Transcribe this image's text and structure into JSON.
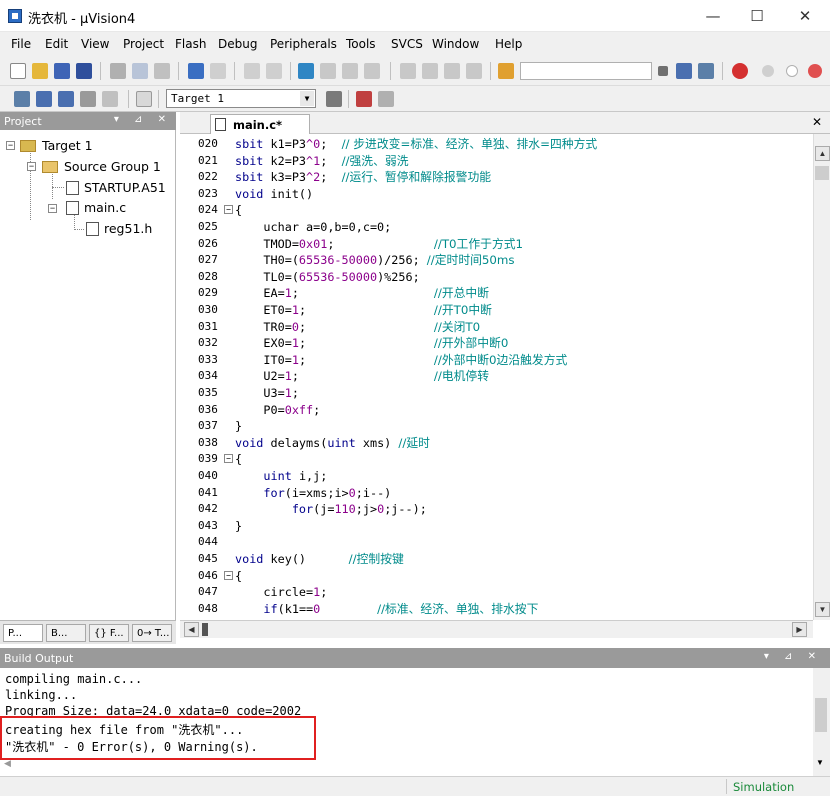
{
  "window": {
    "title": "洗衣机 - µVision4",
    "minimize": "—",
    "maximize": "☐",
    "close": "✕"
  },
  "menu": [
    "File",
    "Edit",
    "View",
    "Project",
    "Flash",
    "Debug",
    "Peripherals",
    "Tools",
    "SVCS",
    "Window",
    "Help"
  ],
  "toolbar": {
    "target": "Target 1"
  },
  "project_panel": {
    "title": "Project",
    "buttons": "▾ ⊿ ✕",
    "tree": {
      "target": "Target 1",
      "group": "Source Group 1",
      "startup": "STARTUP.A51",
      "main": "main.c",
      "header": "reg51.h"
    },
    "tabs": [
      "P...",
      "B...",
      "{} F...",
      "0→ T..."
    ]
  },
  "editor": {
    "tab": "main.c*",
    "close": "✕",
    "lines": [
      {
        "n": "020",
        "fold": "",
        "parts": [
          [
            "kw",
            "sbit "
          ],
          [
            "",
            "k1=P3"
          ],
          [
            "num",
            "^0"
          ],
          [
            "",
            ";  "
          ],
          [
            "cm",
            "//"
          ],
          [
            "cm",
            " 步进改变=标准、经济、单独、排水=四种方式"
          ]
        ]
      },
      {
        "n": "021",
        "fold": "",
        "parts": [
          [
            "kw",
            "sbit "
          ],
          [
            "",
            "k2=P3"
          ],
          [
            "num",
            "^1"
          ],
          [
            "",
            ";  "
          ],
          [
            "cm",
            "//强洗、弱洗"
          ]
        ]
      },
      {
        "n": "022",
        "fold": "",
        "parts": [
          [
            "kw",
            "sbit "
          ],
          [
            "",
            "k3=P3"
          ],
          [
            "num",
            "^2"
          ],
          [
            "",
            ";  "
          ],
          [
            "cm",
            "//运行、暂停和解除报警功能"
          ]
        ]
      },
      {
        "n": "023",
        "fold": "",
        "parts": [
          [
            "kw",
            "void "
          ],
          [
            "",
            "init()"
          ]
        ]
      },
      {
        "n": "024",
        "fold": "−",
        "parts": [
          [
            "",
            "{"
          ]
        ]
      },
      {
        "n": "025",
        "fold": "",
        "parts": [
          [
            "",
            "    uchar a=0,b=0,c=0;"
          ]
        ]
      },
      {
        "n": "026",
        "fold": "",
        "parts": [
          [
            "",
            "    TMOD="
          ],
          [
            "num",
            "0x01"
          ],
          [
            "",
            ";              "
          ],
          [
            "cm",
            "//T0工作于方式1"
          ]
        ]
      },
      {
        "n": "027",
        "fold": "",
        "parts": [
          [
            "",
            "    TH0=("
          ],
          [
            "num",
            "65536-50000"
          ],
          [
            ")",
            ")/256; "
          ],
          [
            "cm",
            "//定时时间50ms"
          ]
        ]
      },
      {
        "n": "028",
        "fold": "",
        "parts": [
          [
            "",
            "    TL0=("
          ],
          [
            "num",
            "65536-50000"
          ],
          [
            ")",
            ")%256;"
          ]
        ]
      },
      {
        "n": "029",
        "fold": "",
        "parts": [
          [
            "",
            "    EA="
          ],
          [
            "num",
            "1"
          ],
          [
            "",
            ";                   "
          ],
          [
            "cm",
            "//开总中断"
          ]
        ]
      },
      {
        "n": "030",
        "fold": "",
        "parts": [
          [
            "",
            "    ET0="
          ],
          [
            "num",
            "1"
          ],
          [
            "",
            ";                  "
          ],
          [
            "cm",
            "//开T0中断"
          ]
        ]
      },
      {
        "n": "031",
        "fold": "",
        "parts": [
          [
            "",
            "    TR0="
          ],
          [
            "num",
            "0"
          ],
          [
            "",
            ";                  "
          ],
          [
            "cm",
            "//关闭T0"
          ]
        ]
      },
      {
        "n": "032",
        "fold": "",
        "parts": [
          [
            "",
            "    EX0="
          ],
          [
            "num",
            "1"
          ],
          [
            "",
            ";                  "
          ],
          [
            "cm",
            "//开外部中断0"
          ]
        ]
      },
      {
        "n": "033",
        "fold": "",
        "parts": [
          [
            "",
            "    IT0="
          ],
          [
            "num",
            "1"
          ],
          [
            "",
            ";                  "
          ],
          [
            "cm",
            "//外部中断0边沿触发方式"
          ]
        ]
      },
      {
        "n": "034",
        "fold": "",
        "parts": [
          [
            "",
            "    U2="
          ],
          [
            "num",
            "1"
          ],
          [
            "",
            ";                   "
          ],
          [
            "cm",
            "//电机停转"
          ]
        ]
      },
      {
        "n": "035",
        "fold": "",
        "parts": [
          [
            "",
            "    U3="
          ],
          [
            "num",
            "1"
          ],
          [
            "",
            ";"
          ]
        ]
      },
      {
        "n": "036",
        "fold": "",
        "parts": [
          [
            "",
            "    P0="
          ],
          [
            "num",
            "0xff"
          ],
          [
            "",
            ";"
          ]
        ]
      },
      {
        "n": "037",
        "fold": "",
        "parts": [
          [
            "",
            "}"
          ]
        ]
      },
      {
        "n": "038",
        "fold": "",
        "parts": [
          [
            "kw",
            "void "
          ],
          [
            "",
            "delayms("
          ],
          [
            "kw",
            "uint "
          ],
          [
            "",
            "xms) "
          ],
          [
            "cm",
            "//延时"
          ]
        ]
      },
      {
        "n": "039",
        "fold": "−",
        "parts": [
          [
            "",
            "{"
          ]
        ]
      },
      {
        "n": "040",
        "fold": "",
        "parts": [
          [
            "",
            "    "
          ],
          [
            "kw",
            "uint "
          ],
          [
            "",
            "i,j;"
          ]
        ]
      },
      {
        "n": "041",
        "fold": "",
        "parts": [
          [
            "",
            "    "
          ],
          [
            "kw",
            "for"
          ],
          [
            "",
            "(i=xms;i>"
          ],
          [
            "num",
            "0"
          ],
          [
            "",
            ";i--)"
          ]
        ]
      },
      {
        "n": "042",
        "fold": "",
        "parts": [
          [
            "",
            "        "
          ],
          [
            "kw",
            "for"
          ],
          [
            "",
            "(j="
          ],
          [
            "num",
            "110"
          ],
          [
            "",
            ";j>"
          ],
          [
            "num",
            "0"
          ],
          [
            "",
            ";j--);"
          ]
        ]
      },
      {
        "n": "043",
        "fold": "",
        "parts": [
          [
            "",
            "}"
          ]
        ]
      },
      {
        "n": "044",
        "fold": "",
        "parts": [
          [
            "",
            ""
          ]
        ]
      },
      {
        "n": "045",
        "fold": "",
        "parts": [
          [
            "kw",
            "void "
          ],
          [
            "",
            "key()      "
          ],
          [
            "cm",
            "//控制按键"
          ]
        ]
      },
      {
        "n": "046",
        "fold": "−",
        "parts": [
          [
            "",
            "{"
          ]
        ]
      },
      {
        "n": "047",
        "fold": "",
        "parts": [
          [
            "",
            "    circle="
          ],
          [
            "num",
            "1"
          ],
          [
            "",
            ";"
          ]
        ]
      },
      {
        "n": "048",
        "fold": "",
        "parts": [
          [
            "",
            "    "
          ],
          [
            "kw",
            "if"
          ],
          [
            "",
            "(k1=="
          ],
          [
            "num",
            "0"
          ],
          [
            ")",
            "        "
          ],
          [
            "cm",
            "//标准、经济、单独、排水按下"
          ]
        ]
      }
    ]
  },
  "build_output": {
    "title": "Build Output",
    "buttons": "▾ ⊿ ✕",
    "lines": [
      "compiling main.c...",
      "linking...",
      "Program Size: data=24.0 xdata=0 code=2002",
      "creating hex file from \"洗衣机\"...",
      "\"洗衣机\" - 0 Error(s), 0 Warning(s)."
    ]
  },
  "status": {
    "mode": "Simulation"
  }
}
